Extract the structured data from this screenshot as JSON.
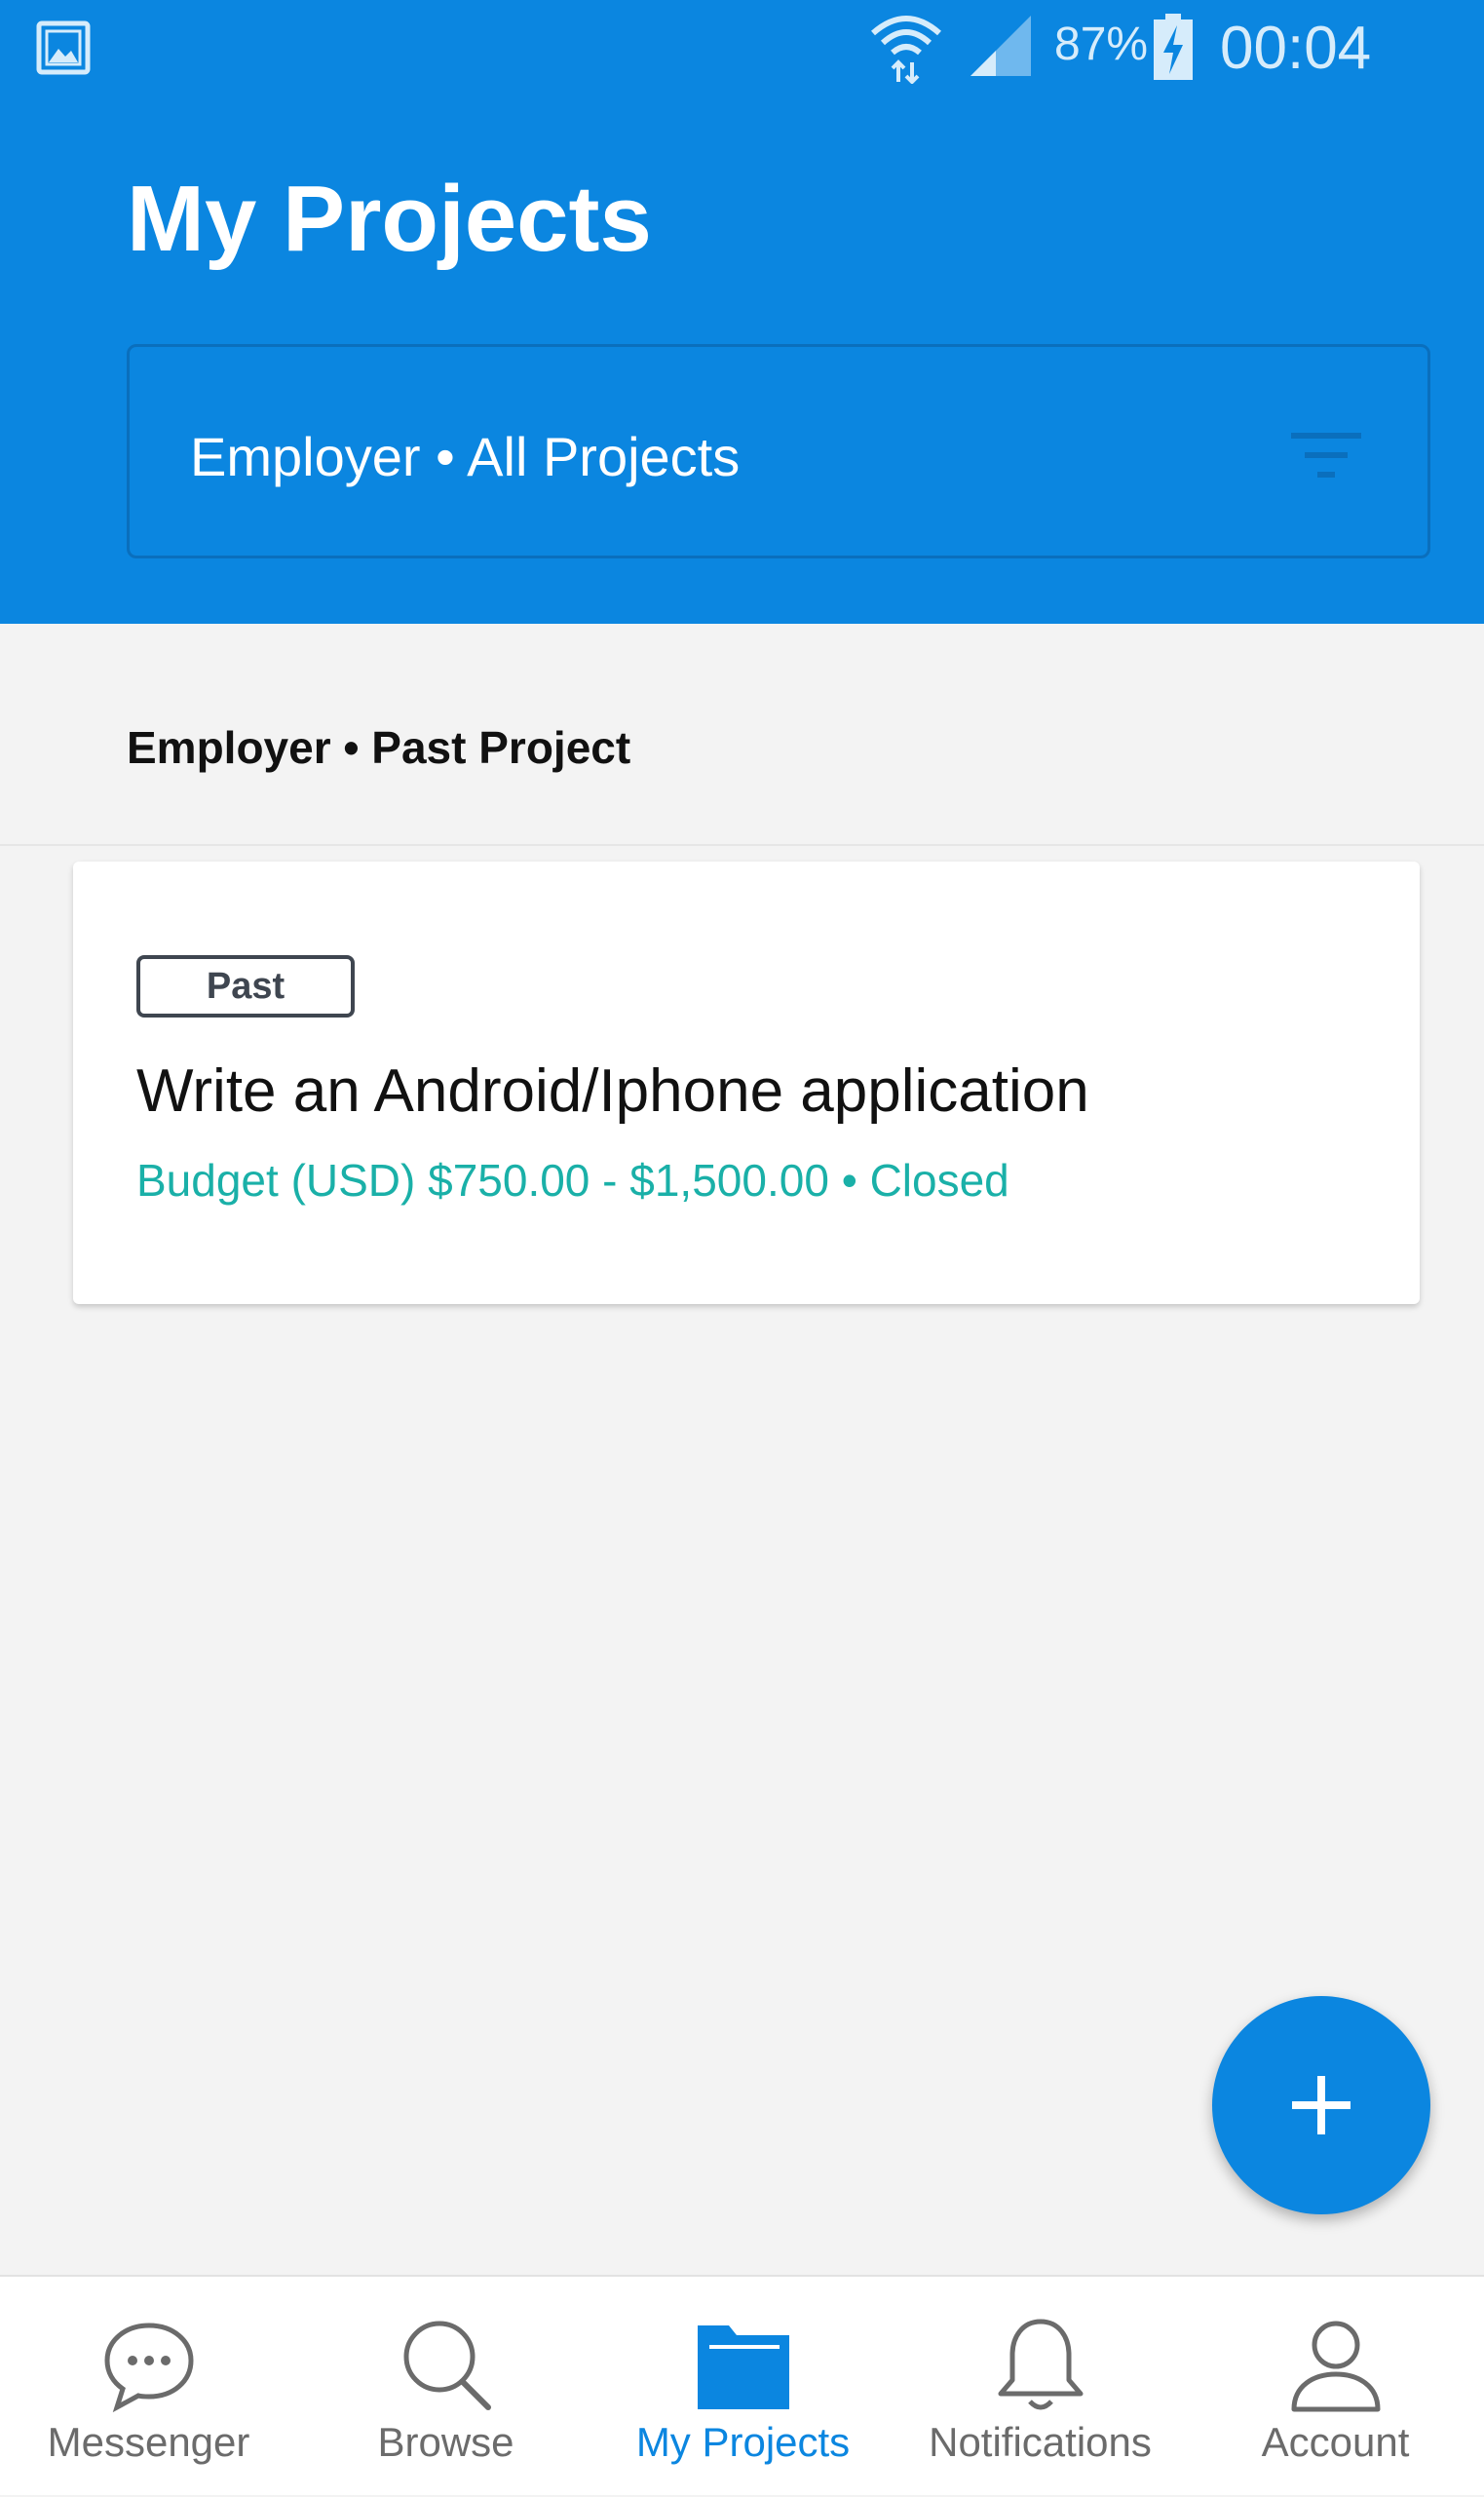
{
  "status_bar": {
    "battery_percent": "87%",
    "time": "00:04",
    "icons": [
      "gallery-icon",
      "wifi-icon",
      "signal-icon",
      "battery-charging-icon"
    ]
  },
  "header": {
    "title": "My Projects",
    "filter_label": "Employer • All Projects",
    "filter_icon": "filter-icon"
  },
  "section": {
    "heading": "Employer • Past Project"
  },
  "project": {
    "status": "Past",
    "title": "Write an Android/Iphone application",
    "budget": "Budget (USD) $750.00 - $1,500.00 • Closed"
  },
  "fab": {
    "icon": "plus-icon"
  },
  "bottom_nav": {
    "items": [
      {
        "label": "Messenger",
        "icon": "chat-bubble-icon"
      },
      {
        "label": "Browse",
        "icon": "search-icon"
      },
      {
        "label": "My Projects",
        "icon": "folder-icon"
      },
      {
        "label": "Notifications",
        "icon": "bell-icon"
      },
      {
        "label": "Account",
        "icon": "person-icon"
      }
    ],
    "active_index": 2
  },
  "colors": {
    "primary": "#0b86e0",
    "budget_text": "#1ab0a8",
    "inactive_nav": "#6b6b6b"
  }
}
